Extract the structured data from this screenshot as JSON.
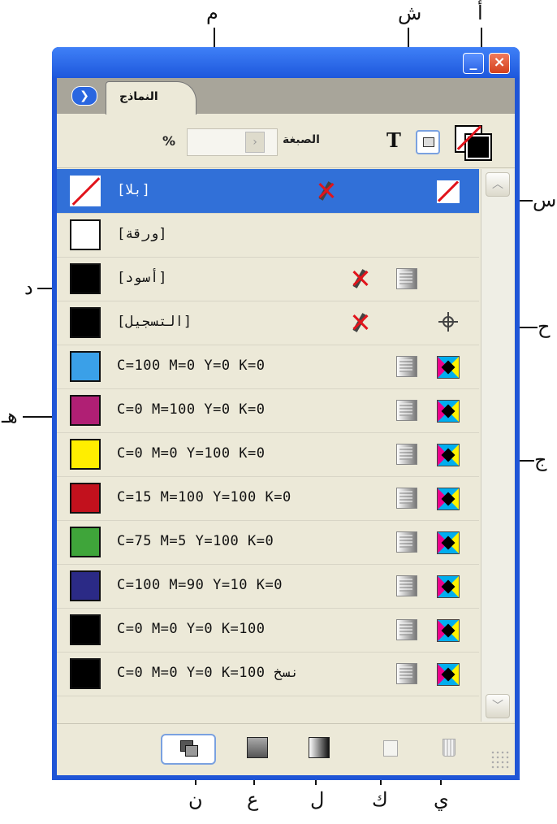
{
  "panel": {
    "tab_label": "النماذج",
    "tint_label": "الصبغة",
    "tint_value": "",
    "tint_unit": "%"
  },
  "callouts": {
    "top": [
      "م",
      "ش",
      "أ"
    ],
    "bottom": [
      "ن",
      "ع",
      "ل",
      "ك",
      "ي"
    ],
    "left": [
      "د",
      "هـ"
    ],
    "right": [
      "س",
      "ح",
      "ج"
    ]
  },
  "swatches": [
    {
      "name": "[بلا]",
      "chip": "none",
      "color": "#ffffff",
      "icons": [
        "noedit",
        "cmode-none"
      ],
      "selected": true
    },
    {
      "name": "[ورقة]",
      "chip": "solid",
      "color": "#ffffff",
      "icons": []
    },
    {
      "name": "[أسود]",
      "chip": "solid",
      "color": "#000000",
      "icons": [
        "noedit",
        "process"
      ]
    },
    {
      "name": "[التسجيل]",
      "chip": "solid",
      "color": "#000000",
      "icons": [
        "noedit",
        "registration"
      ]
    },
    {
      "name": "C=100 M=0 Y=0 K=0",
      "chip": "solid",
      "color": "#3aa0e8",
      "icons": [
        "process",
        "cmyk"
      ]
    },
    {
      "name": "C=0 M=100 Y=0 K=0",
      "chip": "solid",
      "color": "#b01f74",
      "icons": [
        "process",
        "cmyk"
      ]
    },
    {
      "name": "C=0 M=0 Y=100 K=0",
      "chip": "solid",
      "color": "#ffee00",
      "icons": [
        "process",
        "cmyk"
      ]
    },
    {
      "name": "C=15 M=100 Y=100 K=0",
      "chip": "solid",
      "color": "#c2111d",
      "icons": [
        "process",
        "cmyk"
      ]
    },
    {
      "name": "C=75 M=5 Y=100 K=0",
      "chip": "solid",
      "color": "#3fa53a",
      "icons": [
        "process",
        "cmyk"
      ]
    },
    {
      "name": "C=100 M=90 Y=10 K=0",
      "chip": "solid",
      "color": "#2b2a86",
      "icons": [
        "process",
        "cmyk"
      ]
    },
    {
      "name": "C=0 M=0 Y=0 K=100",
      "chip": "solid",
      "color": "#000000",
      "icons": [
        "process",
        "cmyk"
      ]
    },
    {
      "name": "C=0 M=0 Y=0 K=100 نسخ",
      "chip": "solid",
      "color": "#000000",
      "icons": [
        "process",
        "cmyk"
      ]
    }
  ],
  "colors": {
    "titlebar": "#1f55d6",
    "selected_row": "#3170d8",
    "panel_bg": "#ece9d8",
    "none_red": "#e1141c"
  }
}
